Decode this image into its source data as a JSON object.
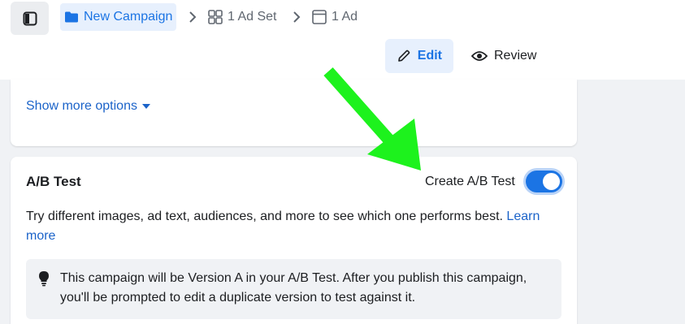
{
  "breadcrumb": {
    "campaign": "New Campaign",
    "ad_set": "1 Ad Set",
    "ad": "1 Ad"
  },
  "modes": {
    "edit": "Edit",
    "review": "Review"
  },
  "options": {
    "show_more": "Show more options"
  },
  "ab_test": {
    "title": "A/B Test",
    "toggle_label": "Create A/B Test",
    "toggle_on": true,
    "description": "Try different images, ad text, audiences, and more to see which one performs best.",
    "learn_more": "Learn more",
    "info": "This campaign will be Version A in your A/B Test. After you publish this campaign, you'll be prompted to edit a duplicate version to test against it."
  },
  "colors": {
    "accent": "#1b74e4",
    "link": "#1b63c9",
    "arrow": "#1df21d",
    "background": "#f0f2f5"
  }
}
